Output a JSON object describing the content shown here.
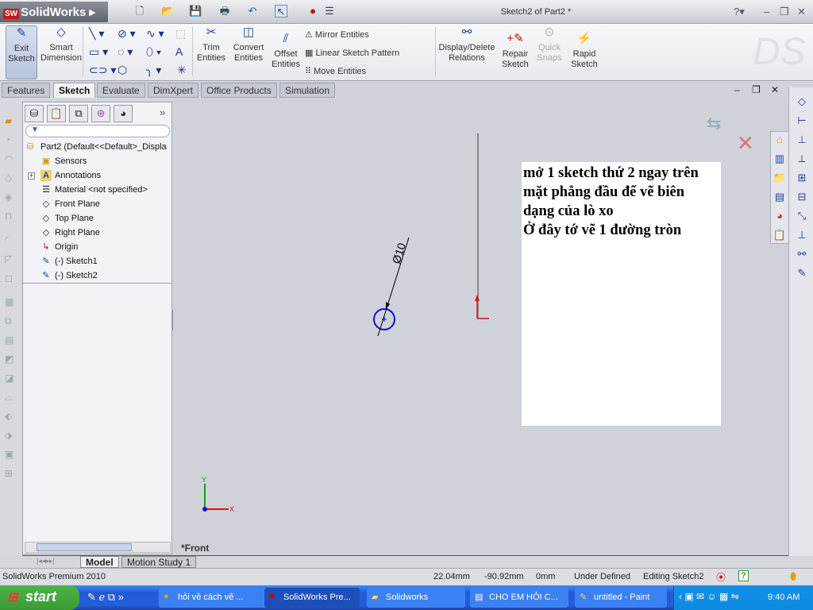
{
  "app": {
    "brand": "SolidWorks",
    "window_title": "Sketch2 of Part2 *"
  },
  "ribbon": {
    "exit_sketch": "Exit Sketch",
    "smart_dimension": "Smart Dimension",
    "trim": "Trim Entities",
    "convert": "Convert Entities",
    "offset": "Offset Entities",
    "mirror": "Mirror Entities",
    "linear_pattern": "Linear Sketch Pattern",
    "move": "Move Entities",
    "display_delete": "Display/Delete Relations",
    "repair": "Repair Sketch",
    "quick_snaps": "Quick Snaps",
    "rapid": "Rapid Sketch"
  },
  "tabs": [
    "Features",
    "Sketch",
    "Evaluate",
    "DimXpert",
    "Office Products",
    "Simulation"
  ],
  "active_tab": "Sketch",
  "tree": {
    "root": "Part2  (Default<<Default>_Displa",
    "items": [
      "Sensors",
      "Annotations",
      "Material <not specified>",
      "Front Plane",
      "Top Plane",
      "Right Plane",
      "Origin",
      "(-) Sketch1",
      "(-) Sketch2"
    ]
  },
  "canvas": {
    "dimension": "Ø10",
    "view_label": "*Front",
    "axis_x": "X",
    "axis_y": "Y",
    "note": [
      "mở 1 sketch thứ 2 ngay trên",
      "mặt phẳng đầu để vẽ biên",
      "dạng của lò xo",
      "Ở đây tớ vẽ 1 đường tròn"
    ]
  },
  "bottom_tabs": [
    "Model",
    "Motion Study 1"
  ],
  "status": {
    "product": "SolidWorks Premium 2010",
    "x": "22.04mm",
    "y": "-90.92mm",
    "z": "0mm",
    "state": "Under Defined",
    "mode": "Editing Sketch2"
  },
  "taskbar": {
    "start": "start",
    "buttons": [
      "hỏi về cách vẽ ...",
      "SolidWorks Pre...",
      "Solidworks",
      "CHO EM HỎI C...",
      "untitled - Paint"
    ],
    "active": "SolidWorks Pre...",
    "clock": "9:40 AM"
  },
  "colors": {
    "sketch_circle": "#1010d0",
    "origin": "#e01010",
    "canvas": "#cfd2d9"
  }
}
